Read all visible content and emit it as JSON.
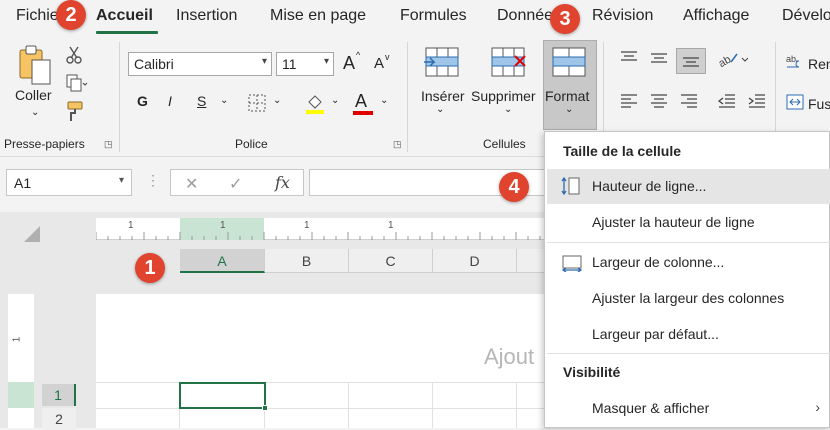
{
  "tabs": [
    "Fichier",
    "Accueil",
    "Insertion",
    "Mise en page",
    "Formules",
    "Données",
    "Révision",
    "Affichage",
    "Dévelo"
  ],
  "active_tab": "Accueil",
  "ribbon": {
    "clipboard": {
      "paste_label": "Coller",
      "group_label": "Presse-papiers"
    },
    "font": {
      "font_name": "Calibri",
      "font_size": "11",
      "bold": "G",
      "italic": "I",
      "underline": "S",
      "grow": "A",
      "shrink": "A",
      "font_color": "A",
      "group_label": "Police",
      "highlight_color": "#ffff00",
      "font_color_bar": "#e00000"
    },
    "cells": {
      "insert_label": "Insérer",
      "delete_label": "Supprimer",
      "format_label": "Format",
      "group_label": "Cellules"
    },
    "alignment": {
      "wrap_label": "Ren",
      "merge_label": "Fus"
    }
  },
  "formula_bar": {
    "name_box": "A1",
    "cancel_icon": "✕",
    "enter_icon": "✓",
    "fx": "fx"
  },
  "sheet": {
    "columns": [
      "A",
      "B",
      "C",
      "D"
    ],
    "selected_column": "A",
    "rows": [
      "1",
      "2"
    ],
    "selected_row": "1",
    "header_hint": "Ajout",
    "ruler_marks": [
      "1",
      "1",
      "1",
      "1"
    ],
    "vruler_mark": "1"
  },
  "format_menu": {
    "section_size": "Taille de la cellule",
    "items": [
      {
        "label": "Hauteur de ligne..."
      },
      {
        "label": "Ajuster la hauteur de ligne"
      },
      {
        "label": "Largeur de colonne..."
      },
      {
        "label": "Ajuster la largeur des colonnes"
      },
      {
        "label": "Largeur par défaut..."
      }
    ],
    "section_visibility": "Visibilité",
    "hide_show": "Masquer & afficher"
  },
  "callouts": [
    "1",
    "2",
    "3",
    "4"
  ],
  "colors": {
    "accent_green": "#217346",
    "callout_red": "#e0432e",
    "menu_highlight": "#e5e5e5"
  }
}
